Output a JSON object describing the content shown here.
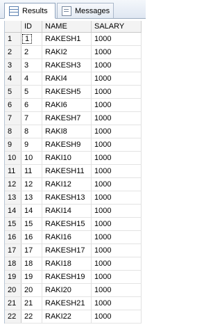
{
  "tabs": {
    "results_label": "Results",
    "messages_label": "Messages"
  },
  "grid": {
    "columns": [
      "",
      "ID",
      "NAME",
      "SALARY"
    ],
    "rows": [
      {
        "num": "1",
        "id": "1",
        "name": "RAKESH1",
        "salary": "1000"
      },
      {
        "num": "2",
        "id": "2",
        "name": "RAKI2",
        "salary": "1000"
      },
      {
        "num": "3",
        "id": "3",
        "name": "RAKESH3",
        "salary": "1000"
      },
      {
        "num": "4",
        "id": "4",
        "name": "RAKI4",
        "salary": "1000"
      },
      {
        "num": "5",
        "id": "5",
        "name": "RAKESH5",
        "salary": "1000"
      },
      {
        "num": "6",
        "id": "6",
        "name": "RAKI6",
        "salary": "1000"
      },
      {
        "num": "7",
        "id": "7",
        "name": "RAKESH7",
        "salary": "1000"
      },
      {
        "num": "8",
        "id": "8",
        "name": "RAKI8",
        "salary": "1000"
      },
      {
        "num": "9",
        "id": "9",
        "name": "RAKESH9",
        "salary": "1000"
      },
      {
        "num": "10",
        "id": "10",
        "name": "RAKI10",
        "salary": "1000"
      },
      {
        "num": "11",
        "id": "11",
        "name": "RAKESH11",
        "salary": "1000"
      },
      {
        "num": "12",
        "id": "12",
        "name": "RAKI12",
        "salary": "1000"
      },
      {
        "num": "13",
        "id": "13",
        "name": "RAKESH13",
        "salary": "1000"
      },
      {
        "num": "14",
        "id": "14",
        "name": "RAKI14",
        "salary": "1000"
      },
      {
        "num": "15",
        "id": "15",
        "name": "RAKESH15",
        "salary": "1000"
      },
      {
        "num": "16",
        "id": "16",
        "name": "RAKI16",
        "salary": "1000"
      },
      {
        "num": "17",
        "id": "17",
        "name": "RAKESH17",
        "salary": "1000"
      },
      {
        "num": "18",
        "id": "18",
        "name": "RAKI18",
        "salary": "1000"
      },
      {
        "num": "19",
        "id": "19",
        "name": "RAKESH19",
        "salary": "1000"
      },
      {
        "num": "20",
        "id": "20",
        "name": "RAKI20",
        "salary": "1000"
      },
      {
        "num": "21",
        "id": "21",
        "name": "RAKESH21",
        "salary": "1000"
      },
      {
        "num": "22",
        "id": "22",
        "name": "RAKI22",
        "salary": "1000"
      }
    ]
  }
}
